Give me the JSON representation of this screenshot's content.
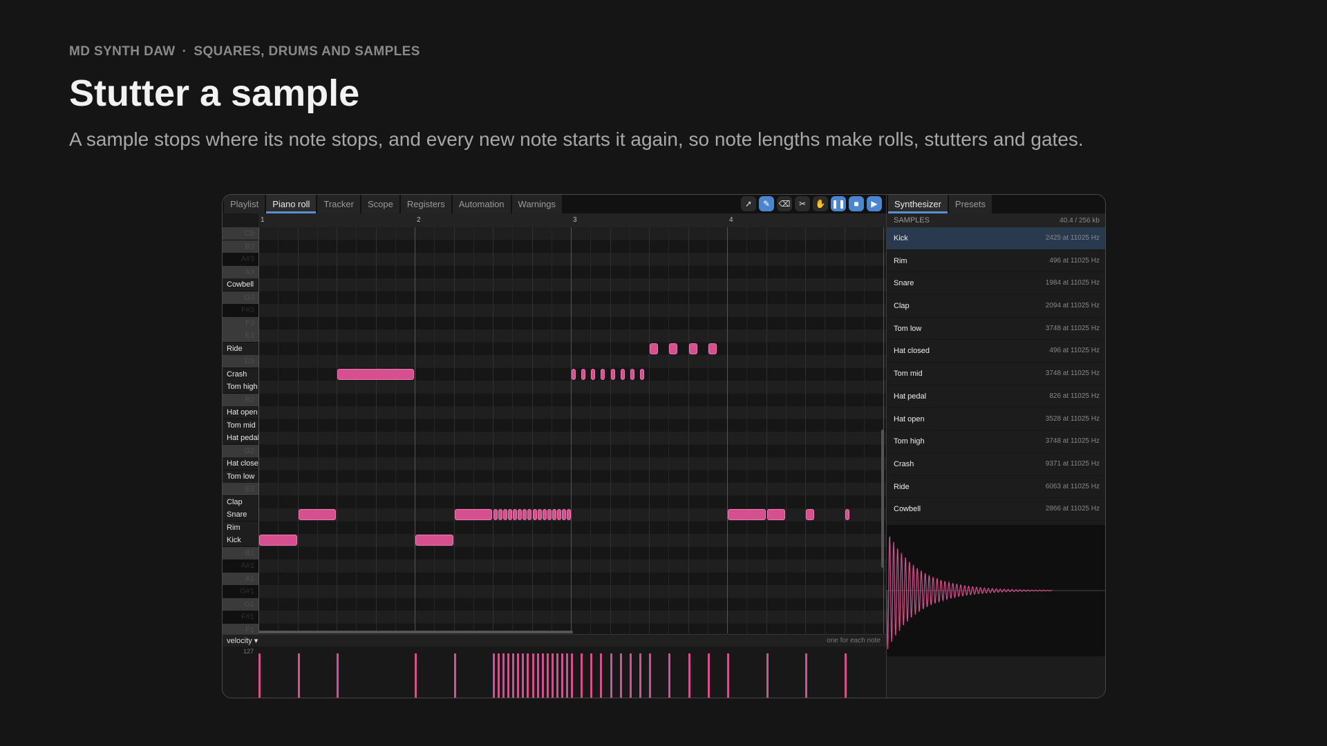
{
  "hero": {
    "eyebrow_app": "MD SYNTH DAW",
    "eyebrow_sep": "·",
    "eyebrow_section": "SQUARES, DRUMS AND SAMPLES",
    "title": "Stutter a sample",
    "subtitle": "A sample stops where its note stops, and every new note starts it again, so note lengths make rolls, stutters and gates."
  },
  "tabs": [
    "Playlist",
    "Piano roll",
    "Tracker",
    "Scope",
    "Registers",
    "Automation",
    "Warnings"
  ],
  "active_tab": "Piano roll",
  "toolbar": [
    "cursor-icon",
    "pencil-icon",
    "eraser-icon",
    "cut-icon",
    "hand-icon",
    "pause-icon",
    "stop-icon",
    "play-icon"
  ],
  "ruler": [
    "1",
    "2",
    "3",
    "4"
  ],
  "keys": [
    "C5",
    "B3",
    "A#3",
    "A3",
    "Cowbell",
    "G3",
    "F#3",
    "F3",
    "E3",
    "Ride",
    "D3",
    "Crash",
    "Tom high",
    "B2",
    "Hat open",
    "Tom mid",
    "Hat pedal",
    "G2",
    "Hat closed",
    "Tom low",
    "E2",
    "Clap",
    "Snare",
    "Rim",
    "Kick",
    "B1",
    "A#1",
    "A1",
    "G#1",
    "G1",
    "F#1",
    "F1"
  ],
  "velocity": {
    "label": "velocity ▾",
    "max": "127",
    "hint": "one for each note"
  },
  "side_tabs": [
    "Synthesizer",
    "Presets"
  ],
  "samples_header": {
    "title": "SAMPLES",
    "usage": "40.4 / 256 kb"
  },
  "samples": [
    {
      "name": "Kick",
      "info": "2425 at 11025 Hz"
    },
    {
      "name": "Rim",
      "info": "496 at 11025 Hz"
    },
    {
      "name": "Snare",
      "info": "1984 at 11025 Hz"
    },
    {
      "name": "Clap",
      "info": "2094 at 11025 Hz"
    },
    {
      "name": "Tom low",
      "info": "3748 at 11025 Hz"
    },
    {
      "name": "Hat closed",
      "info": "496 at 11025 Hz"
    },
    {
      "name": "Tom mid",
      "info": "3748 at 11025 Hz"
    },
    {
      "name": "Hat pedal",
      "info": "826 at 11025 Hz"
    },
    {
      "name": "Hat open",
      "info": "3528 at 11025 Hz"
    },
    {
      "name": "Tom high",
      "info": "3748 at 11025 Hz"
    },
    {
      "name": "Crash",
      "info": "9371 at 11025 Hz"
    },
    {
      "name": "Ride",
      "info": "6063 at 11025 Hz"
    },
    {
      "name": "Cowbell",
      "info": "2866 at 11025 Hz"
    }
  ],
  "selected_sample": "Kick",
  "colors": {
    "note": "#d6508f",
    "accent": "#4a86cf",
    "selected_row": "#2a3a4e"
  }
}
